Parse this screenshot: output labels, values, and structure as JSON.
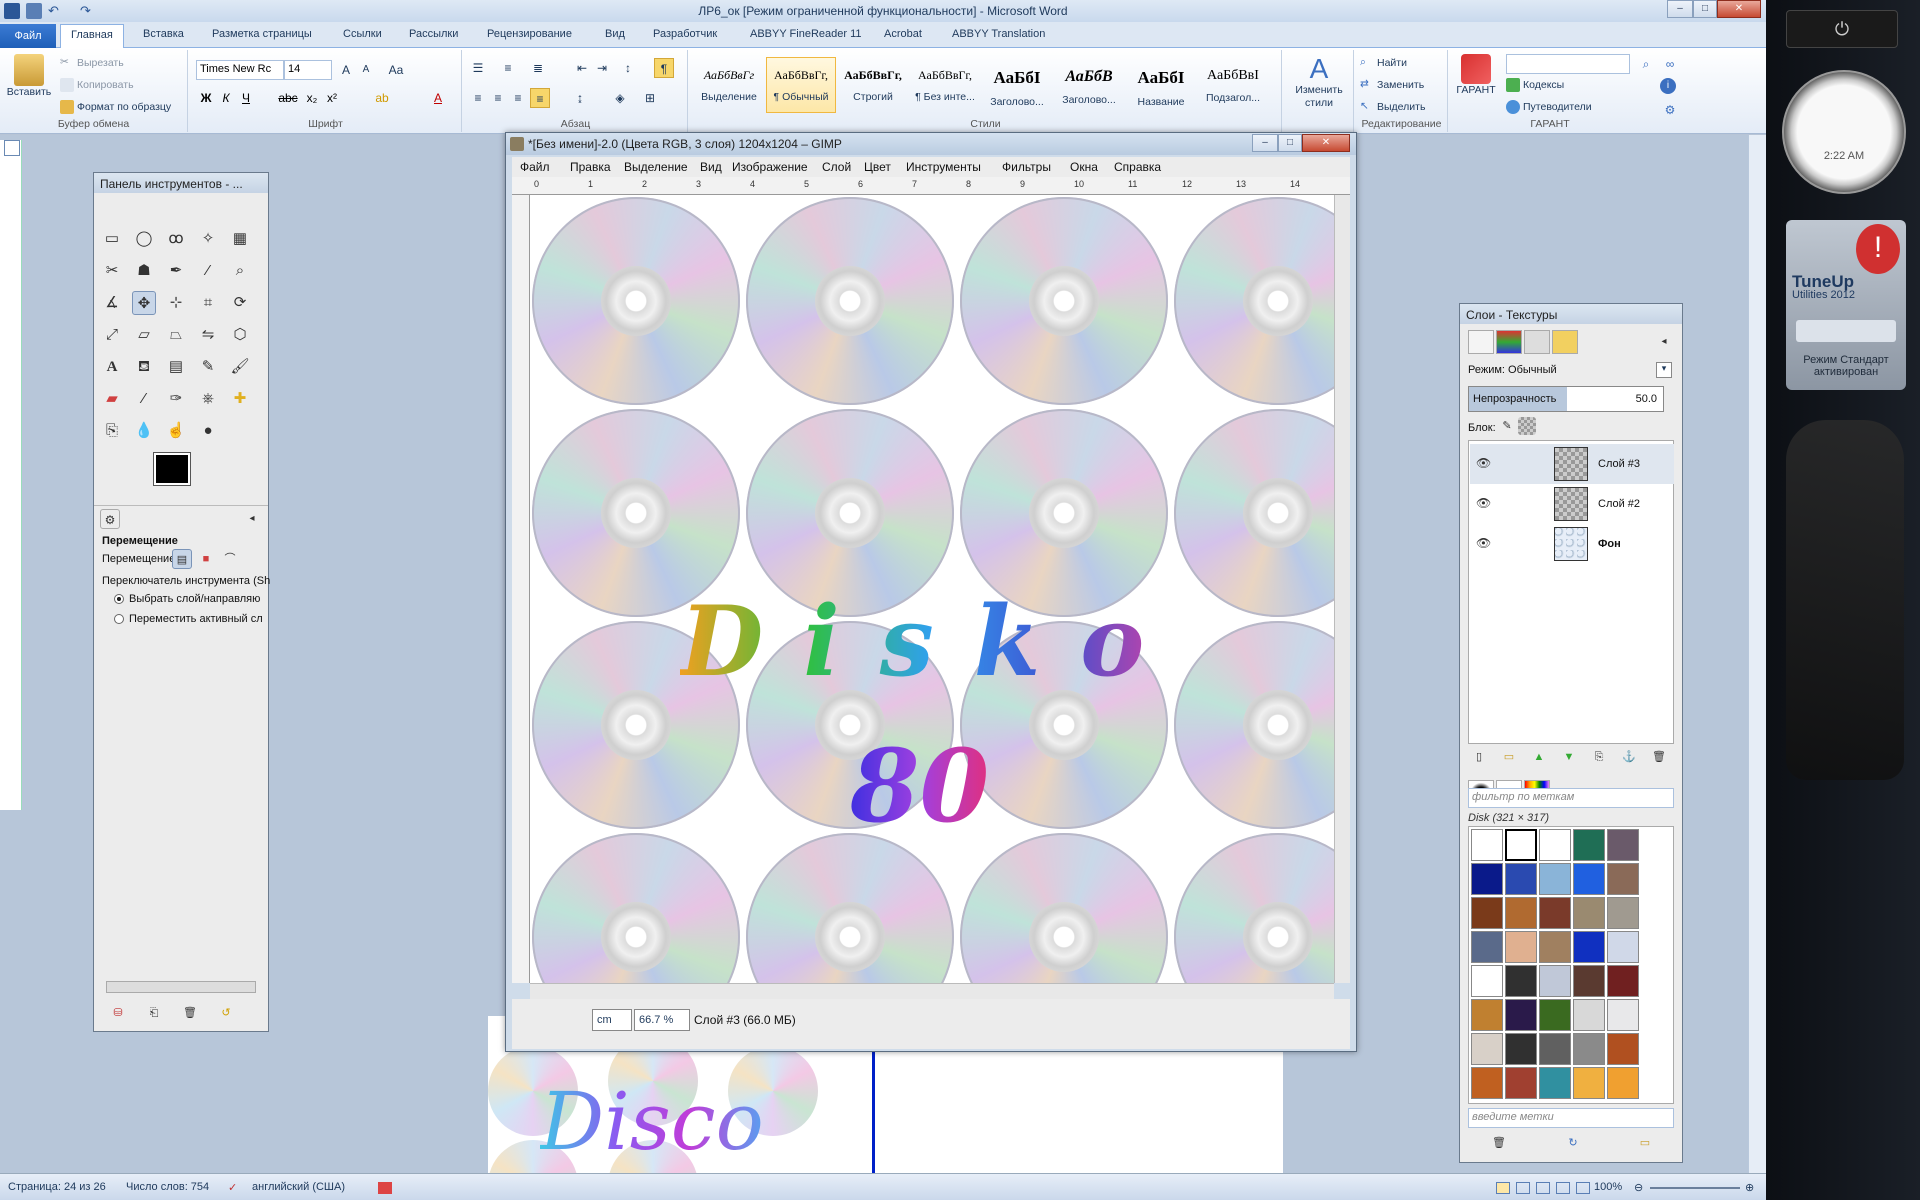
{
  "word": {
    "title": "ЛР6_ок [Режим ограниченной функциональности] - Microsoft Word",
    "file_tab": "Файл",
    "tabs": [
      "Главная",
      "Вставка",
      "Разметка страницы",
      "Ссылки",
      "Рассылки",
      "Рецензирование",
      "Вид",
      "Разработчик",
      "ABBYY FineReader 11",
      "Acrobat",
      "ABBYY Translation"
    ],
    "clipboard": {
      "paste": "Вставить",
      "cut": "Вырезать",
      "copy": "Копировать",
      "format_painter": "Формат по образцу",
      "label": "Буфер обмена"
    },
    "font": {
      "name": "Times New Rc",
      "size": "14",
      "label": "Шрифт"
    },
    "paragraph_label": "Абзац",
    "styles": {
      "label": "Стили",
      "items": [
        {
          "sample": "АаБбВвГг",
          "name": "Выделение"
        },
        {
          "sample": "АаБбВвГг,",
          "name": "¶ Обычный"
        },
        {
          "sample": "АаБбВвГг,",
          "name": "Строгий"
        },
        {
          "sample": "АаБбВвГг,",
          "name": "¶ Без инте..."
        },
        {
          "sample": "АаБбI",
          "name": "Заголово..."
        },
        {
          "sample": "АаБбВ",
          "name": "Заголово..."
        },
        {
          "sample": "АаБбI",
          "name": "Название"
        },
        {
          "sample": "АаБбВвI",
          "name": "Подзагол..."
        }
      ],
      "change": "Изменить стили"
    },
    "editing": {
      "find": "Найти",
      "replace": "Заменить",
      "select": "Выделить",
      "label": "Редактирование"
    },
    "garant": {
      "label": "ГАРАНТ",
      "codes": "Кодексы",
      "guides": "Путеводители",
      "button": "ГАРАНТ"
    },
    "disco_text": "Disco",
    "status": {
      "page": "Страница: 24 из 26",
      "words": "Число слов: 754",
      "lang": "английский (США)",
      "zoom": "100%"
    }
  },
  "gimp": {
    "title": "*[Без имени]-2.0 (Цвета RGB, 3 слоя) 1204x1204 – GIMP",
    "menu": [
      "Файл",
      "Правка",
      "Выделение",
      "Вид",
      "Изображение",
      "Слой",
      "Цвет",
      "Инструменты",
      "Фильтры",
      "Окна",
      "Справка"
    ],
    "canvas_text_1": "Disko",
    "canvas_text_2": "80",
    "unit": "cm",
    "zoom": "66.7 %",
    "layer_info": "Слой #3 (66.0 МБ)",
    "ruler_ticks": [
      "0",
      "1",
      "2",
      "3",
      "4",
      "5",
      "6",
      "7",
      "8",
      "9",
      "10",
      "11",
      "12",
      "13",
      "14"
    ]
  },
  "toolbox": {
    "title": "Панель инструментов - ...",
    "options_title": "Перемещение",
    "move_label": "Перемещение:",
    "switch_label": "Переключатель инструмента (Sh",
    "option1": "Выбрать слой/направляю",
    "option2": "Переместить активный сл"
  },
  "layers": {
    "title": "Слои - Текстуры",
    "mode_label": "Режим: Обычный",
    "opacity_label": "Непрозрачность",
    "opacity_value": "50.0",
    "lock_label": "Блок:",
    "items": [
      "Слой #3",
      "Слой #2",
      "Фон"
    ],
    "filter_placeholder": "фильтр по меткам",
    "texture_name": "Disk (321 × 317)",
    "tags_placeholder": "введите метки"
  },
  "sidebar": {
    "clock_time": "2:22 AM",
    "tuneup_title": "TuneUp",
    "tuneup_sub": "Utilities 2012",
    "tuneup_mode": "Режим Стандарт активирован"
  }
}
